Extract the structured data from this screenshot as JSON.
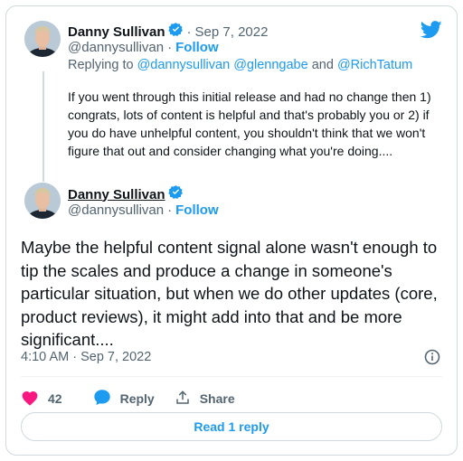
{
  "tweet1": {
    "author_name": "Danny Sullivan",
    "separator": "·",
    "date": "Sep 7, 2022",
    "handle": "@dannysullivan",
    "follow_label": "Follow",
    "replying_prefix": "Replying to",
    "mention1": "@dannysullivan",
    "mention2": "@glenngabe",
    "mention_joiner": "and",
    "mention3": "@RichTatum",
    "text": "If you went through this initial release and had no change then 1) congrats, lots of content is helpful and that's probably you or 2) if you do have unhelpful content, you shouldn't think that we won't figure that out and consider changing what you're doing...."
  },
  "tweet2": {
    "author_name": "Danny Sullivan",
    "handle": "@dannysullivan",
    "separator": "·",
    "follow_label": "Follow",
    "text": "Maybe the helpful content signal alone wasn't enough to tip the scales and produce a change in someone's particular situation, but when we do other updates (core, product reviews), it might add into that and be more significant....",
    "timestamp": "4:10 AM · Sep 7, 2022"
  },
  "actions": {
    "like_count": "42",
    "reply_label": "Reply",
    "share_label": "Share"
  },
  "read_replies_label": "Read 1 reply",
  "icons": {
    "brand": "twitter-bird-icon",
    "verified": "verified-badge-icon",
    "info": "info-icon",
    "like": "heart-icon",
    "reply": "comment-bubble-icon",
    "share": "share-icon"
  },
  "colors": {
    "accent": "#1d9bf0",
    "like": "#f91880",
    "text": "#0f1419",
    "muted": "#536471",
    "border": "#cfd9de"
  }
}
